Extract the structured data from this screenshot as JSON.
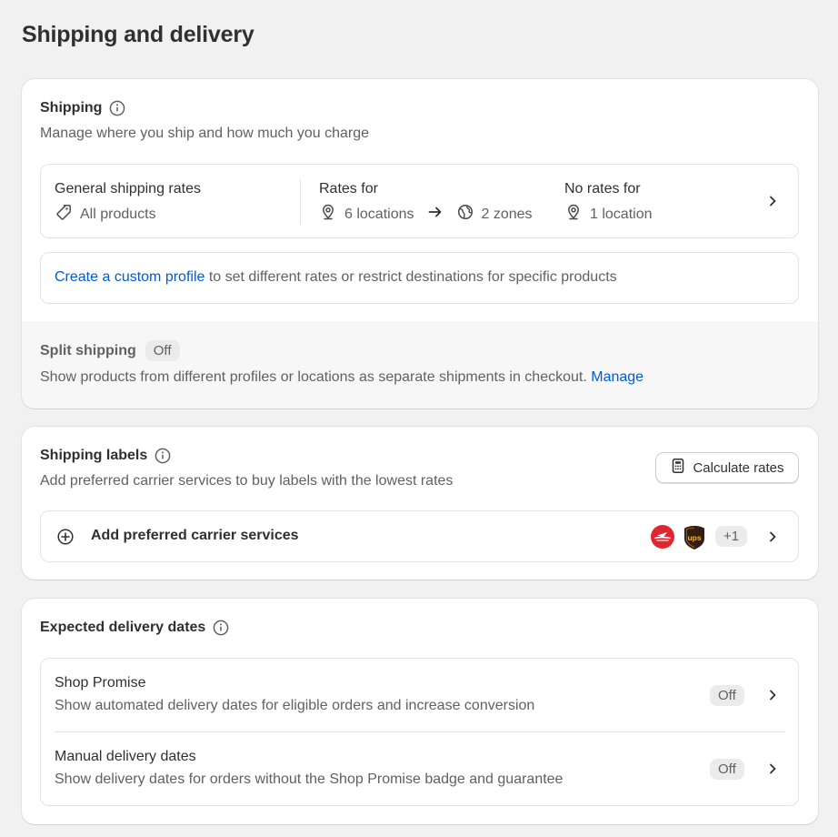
{
  "page": {
    "title": "Shipping and delivery"
  },
  "shipping": {
    "title": "Shipping",
    "subtitle": "Manage where you ship and how much you charge",
    "general": {
      "label": "General shipping rates",
      "products": "All products",
      "rates_for_label": "Rates for",
      "locations": "6 locations",
      "zones": "2 zones",
      "no_rates_label": "No rates for",
      "no_rate_locations": "1 location"
    },
    "custom_profile": {
      "link": "Create a custom profile",
      "text": " to set different rates or restrict destinations for specific products"
    },
    "split": {
      "title": "Split shipping",
      "status": "Off",
      "description": "Show products from different profiles or locations as separate shipments in checkout. ",
      "manage_link": "Manage"
    }
  },
  "labels": {
    "title": "Shipping labels",
    "subtitle": "Add preferred carrier services to buy labels with the lowest rates",
    "calculate_button": "Calculate rates",
    "carrier_label": "Add preferred carrier services",
    "more_count": "+1",
    "carrier_icons": [
      "canada-post-icon",
      "ups-icon"
    ]
  },
  "delivery": {
    "title": "Expected delivery dates",
    "shop_promise": {
      "title": "Shop Promise",
      "description": "Show automated delivery dates for eligible orders and increase conversion",
      "status": "Off"
    },
    "manual": {
      "title": "Manual delivery dates",
      "description": "Show delivery dates for orders without the Shop Promise badge and guarantee",
      "status": "Off"
    }
  },
  "colors": {
    "background": "#f1f1f1",
    "card": "#ffffff",
    "link": "#005bd3",
    "text": "#303030",
    "muted": "#616161",
    "canada_post": "#e0262f",
    "ups": "#351c15",
    "ups_gold": "#ffb500"
  }
}
